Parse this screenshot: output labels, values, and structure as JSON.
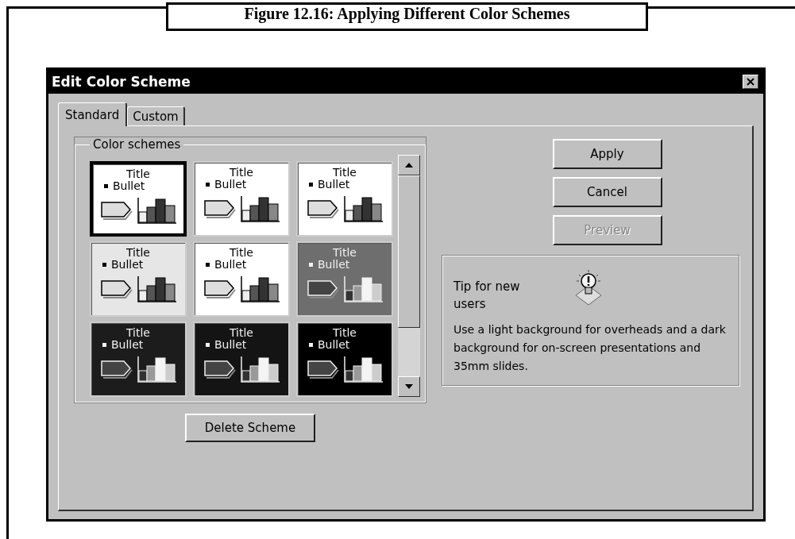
{
  "caption": "Figure 12.16: Applying Different Color Schemes",
  "window": {
    "title": "Edit Color Scheme"
  },
  "tabs": [
    {
      "label": "Standard",
      "selected": true
    },
    {
      "label": "Custom",
      "selected": false
    }
  ],
  "schemes_group": {
    "label": "Color schemes"
  },
  "schemes": [
    {
      "title": "Title",
      "bullet": "Bullet",
      "color": "#ffffff",
      "selected": true
    },
    {
      "title": "Title",
      "bullet": "Bullet",
      "color": "#ffffff",
      "selected": false
    },
    {
      "title": "Title",
      "bullet": "Bullet",
      "color": "#ffffff",
      "selected": false
    },
    {
      "title": "Title",
      "bullet": "Bullet",
      "color": "#e6e6e6",
      "selected": false
    },
    {
      "title": "Title",
      "bullet": "Bullet",
      "color": "#ffffff",
      "selected": false
    },
    {
      "title": "Title",
      "bullet": "Bullet",
      "color": "#6e6e6e",
      "selected": false
    },
    {
      "title": "Title",
      "bullet": "Bullet",
      "color": "#1c1c1c",
      "selected": false
    },
    {
      "title": "Title",
      "bullet": "Bullet",
      "color": "#141414",
      "selected": false
    },
    {
      "title": "Title",
      "bullet": "Bullet",
      "color": "#000000",
      "selected": false
    }
  ],
  "delete_button": "Delete Scheme",
  "buttons": [
    {
      "label": "Apply",
      "disabled": false
    },
    {
      "label": "Cancel",
      "disabled": false
    },
    {
      "label": "Preview",
      "disabled": true
    }
  ],
  "tip": {
    "heading": "Tip for new users",
    "text": "Use a light background for overheads and a dark background for on-screen presentations and 35mm slides."
  }
}
